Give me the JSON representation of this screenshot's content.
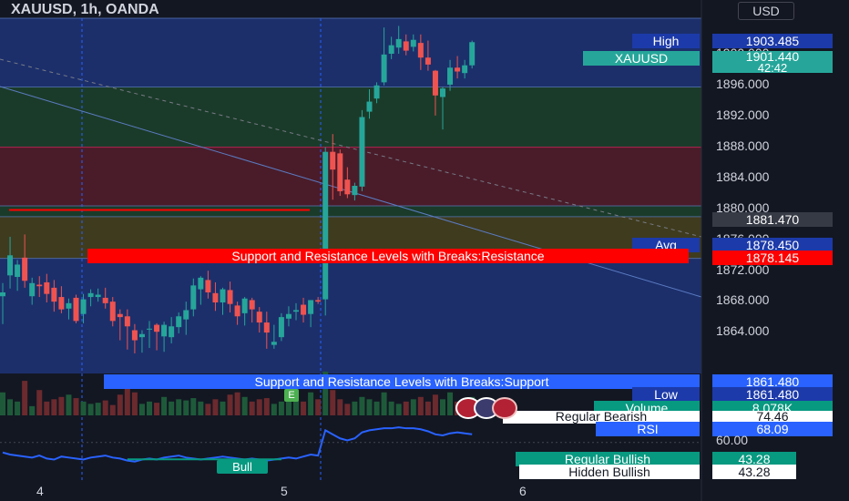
{
  "header": {
    "symbol_line": "XAUUSD, 1h, OANDA"
  },
  "currency_button": "USD",
  "colors": {
    "background": "#131722",
    "bull_candle": "#26a69a",
    "bear_candle": "#ef5350",
    "rsi_line": "#2962ff",
    "resistance_line": "#ff0000",
    "zone_blue": "#1c2f6b",
    "zone_green": "#1b3b2a",
    "zone_red": "#4a1c2a",
    "zone_olive": "#3f3b1e"
  },
  "labels": {
    "high_label": "High",
    "high_value": "1903.485",
    "symbol_label": "XAUUSD",
    "last_price": "1901.440",
    "countdown": "42:42",
    "crosshair_price": "1881.470",
    "avg_label": "Avg",
    "avg_value": "1878.450",
    "resistance_label": "Support and Resistance Levels with Breaks:Resistance",
    "resistance_value": "1878.145",
    "support_label": "Support and Resistance Levels with Breaks:Support",
    "support_value": "1861.480",
    "low_label": "Low",
    "low_value": "1861.480",
    "volume_label": "Volume",
    "volume_value": "8.078K",
    "regular_bearish_label": "Regular Bearish",
    "regular_bearish_value": "74.46",
    "rsi_label": "RSI",
    "rsi_value": "68.09",
    "rsi_level": "60.00",
    "regular_bullish_label": "Regular Bullish",
    "regular_bullish_value": "43.28",
    "hidden_bullish_label": "Hidden Bullish",
    "hidden_bullish_value": "43.28",
    "bull_marker": "Bull",
    "event_marker": "E"
  },
  "chart_data": {
    "type": "candlestick",
    "title": "XAUUSD, 1h, OANDA",
    "y_ticks": [
      "1900.000",
      "1896.000",
      "1892.000",
      "1888.000",
      "1884.000",
      "1880.000",
      "1876.000",
      "1872.000",
      "1868.000",
      "1864.000"
    ],
    "ylim": [
      1858.5,
      1904.5
    ],
    "x_ticks": [
      "4",
      "5",
      "6"
    ],
    "zones": [
      {
        "from": 1895.6,
        "to": 1904.5,
        "color": "blue"
      },
      {
        "from": 1887.8,
        "to": 1895.6,
        "color": "green"
      },
      {
        "from": 1880.2,
        "to": 1887.8,
        "color": "red"
      },
      {
        "from": 1878.8,
        "to": 1880.2,
        "color": "green"
      },
      {
        "from": 1873.4,
        "to": 1878.8,
        "color": "olive"
      },
      {
        "from": 1858.5,
        "to": 1873.4,
        "color": "blue"
      }
    ],
    "resistance_level": 1878.145,
    "support_level": 1861.48,
    "candles": [
      {
        "o": 1868.5,
        "h": 1870.2,
        "l": 1864.9,
        "c": 1869.0
      },
      {
        "o": 1871.2,
        "h": 1876.2,
        "l": 1869.5,
        "c": 1873.8
      },
      {
        "o": 1871.0,
        "h": 1873.2,
        "l": 1869.2,
        "c": 1872.6
      },
      {
        "o": 1873.5,
        "h": 1876.5,
        "l": 1869.6,
        "c": 1870.5
      },
      {
        "o": 1868.5,
        "h": 1870.9,
        "l": 1867.4,
        "c": 1870.2
      },
      {
        "o": 1870.0,
        "h": 1871.1,
        "l": 1868.4,
        "c": 1869.8
      },
      {
        "o": 1870.3,
        "h": 1871.4,
        "l": 1867.7,
        "c": 1868.8
      },
      {
        "o": 1869.6,
        "h": 1870.6,
        "l": 1866.5,
        "c": 1867.8
      },
      {
        "o": 1868.4,
        "h": 1869.8,
        "l": 1866.3,
        "c": 1866.8
      },
      {
        "o": 1866.9,
        "h": 1868.2,
        "l": 1865.5,
        "c": 1867.6
      },
      {
        "o": 1868.3,
        "h": 1868.7,
        "l": 1865.0,
        "c": 1865.3
      },
      {
        "o": 1866.2,
        "h": 1868.8,
        "l": 1865.0,
        "c": 1868.1
      },
      {
        "o": 1868.4,
        "h": 1869.4,
        "l": 1867.2,
        "c": 1868.9
      },
      {
        "o": 1868.4,
        "h": 1869.5,
        "l": 1867.8,
        "c": 1868.7
      },
      {
        "o": 1868.3,
        "h": 1869.6,
        "l": 1866.9,
        "c": 1867.6
      },
      {
        "o": 1867.8,
        "h": 1868.4,
        "l": 1864.6,
        "c": 1865.3
      },
      {
        "o": 1866.2,
        "h": 1866.8,
        "l": 1862.8,
        "c": 1865.8
      },
      {
        "o": 1865.9,
        "h": 1866.8,
        "l": 1861.6,
        "c": 1864.6
      },
      {
        "o": 1864.1,
        "h": 1864.9,
        "l": 1861.1,
        "c": 1862.8
      },
      {
        "o": 1863.2,
        "h": 1864.1,
        "l": 1861.2,
        "c": 1863.6
      },
      {
        "o": 1864.3,
        "h": 1865.3,
        "l": 1861.8,
        "c": 1864.3
      },
      {
        "o": 1864.8,
        "h": 1865.0,
        "l": 1861.5,
        "c": 1863.9
      },
      {
        "o": 1863.3,
        "h": 1865.2,
        "l": 1861.3,
        "c": 1864.8
      },
      {
        "o": 1863.2,
        "h": 1865.8,
        "l": 1862.4,
        "c": 1864.6
      },
      {
        "o": 1864.5,
        "h": 1866.4,
        "l": 1863.7,
        "c": 1865.9
      },
      {
        "o": 1865.5,
        "h": 1867.8,
        "l": 1863.5,
        "c": 1866.7
      },
      {
        "o": 1866.8,
        "h": 1870.8,
        "l": 1865.9,
        "c": 1869.9
      },
      {
        "o": 1869.4,
        "h": 1871.1,
        "l": 1867.4,
        "c": 1870.9
      },
      {
        "o": 1870.6,
        "h": 1871.8,
        "l": 1868.2,
        "c": 1869.0
      },
      {
        "o": 1868.9,
        "h": 1870.3,
        "l": 1866.6,
        "c": 1867.7
      },
      {
        "o": 1867.7,
        "h": 1869.6,
        "l": 1866.1,
        "c": 1869.4
      },
      {
        "o": 1869.3,
        "h": 1870.4,
        "l": 1866.4,
        "c": 1867.5
      },
      {
        "o": 1867.3,
        "h": 1867.8,
        "l": 1864.8,
        "c": 1865.9
      },
      {
        "o": 1866.3,
        "h": 1868.4,
        "l": 1864.7,
        "c": 1868.2
      },
      {
        "o": 1868.0,
        "h": 1868.3,
        "l": 1865.1,
        "c": 1866.8
      },
      {
        "o": 1866.5,
        "h": 1867.1,
        "l": 1863.8,
        "c": 1865.1
      },
      {
        "o": 1865.1,
        "h": 1866.5,
        "l": 1861.7,
        "c": 1863.8
      },
      {
        "o": 1862.2,
        "h": 1864.8,
        "l": 1861.7,
        "c": 1862.6
      },
      {
        "o": 1863.2,
        "h": 1866.3,
        "l": 1862.7,
        "c": 1865.8
      },
      {
        "o": 1865.6,
        "h": 1867.2,
        "l": 1864.6,
        "c": 1866.2
      },
      {
        "o": 1866.5,
        "h": 1867.6,
        "l": 1865.4,
        "c": 1866.7
      },
      {
        "o": 1867.4,
        "h": 1868.3,
        "l": 1865.1,
        "c": 1866.1
      },
      {
        "o": 1866.2,
        "h": 1868.0,
        "l": 1864.5,
        "c": 1868.0
      },
      {
        "o": 1868.0,
        "h": 1868.4,
        "l": 1867.5,
        "c": 1867.8
      },
      {
        "o": 1868.1,
        "h": 1887.8,
        "l": 1866.0,
        "c": 1887.2
      },
      {
        "o": 1887.2,
        "h": 1889.5,
        "l": 1881.0,
        "c": 1884.9
      },
      {
        "o": 1887.0,
        "h": 1887.5,
        "l": 1881.5,
        "c": 1882.1
      },
      {
        "o": 1883.6,
        "h": 1885.2,
        "l": 1881.2,
        "c": 1881.7
      },
      {
        "o": 1881.6,
        "h": 1883.2,
        "l": 1880.9,
        "c": 1882.8
      },
      {
        "o": 1882.7,
        "h": 1892.6,
        "l": 1882.1,
        "c": 1891.7
      },
      {
        "o": 1892.4,
        "h": 1895.3,
        "l": 1891.5,
        "c": 1893.7
      },
      {
        "o": 1894.1,
        "h": 1896.2,
        "l": 1893.5,
        "c": 1895.8
      },
      {
        "o": 1896.2,
        "h": 1903.3,
        "l": 1895.8,
        "c": 1899.8
      },
      {
        "o": 1899.9,
        "h": 1902.1,
        "l": 1899.2,
        "c": 1901.0
      },
      {
        "o": 1900.7,
        "h": 1903.5,
        "l": 1899.9,
        "c": 1901.8
      },
      {
        "o": 1901.5,
        "h": 1902.4,
        "l": 1899.7,
        "c": 1900.3
      },
      {
        "o": 1900.8,
        "h": 1902.4,
        "l": 1900.2,
        "c": 1901.7
      },
      {
        "o": 1901.3,
        "h": 1902.4,
        "l": 1897.8,
        "c": 1899.4
      },
      {
        "o": 1899.4,
        "h": 1901.6,
        "l": 1897.7,
        "c": 1898.5
      },
      {
        "o": 1897.7,
        "h": 1897.8,
        "l": 1891.9,
        "c": 1894.5
      },
      {
        "o": 1894.3,
        "h": 1895.6,
        "l": 1890.1,
        "c": 1895.4
      },
      {
        "o": 1895.9,
        "h": 1899.1,
        "l": 1895.1,
        "c": 1898.1
      },
      {
        "o": 1898.1,
        "h": 1899.6,
        "l": 1896.7,
        "c": 1897.6
      },
      {
        "o": 1897.4,
        "h": 1899.1,
        "l": 1896.7,
        "c": 1898.4
      },
      {
        "o": 1898.4,
        "h": 1901.6,
        "l": 1898.0,
        "c": 1901.4
      }
    ],
    "volume": [
      20,
      14,
      12,
      30,
      8,
      22,
      12,
      14,
      16,
      18,
      15,
      12,
      10,
      11,
      13,
      9,
      18,
      25,
      20,
      10,
      12,
      11,
      16,
      12,
      14,
      13,
      15,
      12,
      10,
      14,
      12,
      18,
      20,
      16,
      12,
      14,
      15,
      10,
      12,
      14,
      16,
      12,
      20,
      14,
      38,
      22,
      14,
      10,
      12,
      16,
      14,
      12,
      20,
      12,
      10,
      12,
      14,
      16,
      12,
      18,
      14,
      20,
      12,
      14,
      16
    ],
    "rsi": {
      "ylim": [
        20,
        85
      ],
      "values": [
        50,
        48,
        47,
        46,
        45,
        47,
        44,
        43,
        46,
        45,
        44,
        43,
        45,
        46,
        47,
        45,
        44,
        42,
        41,
        43,
        44,
        43,
        45,
        46,
        47,
        45,
        44,
        43,
        44,
        45,
        46,
        45,
        44,
        43,
        44,
        43,
        42,
        43,
        44,
        45,
        44,
        46,
        48,
        47,
        72,
        68,
        64,
        62,
        64,
        70,
        72,
        73,
        74,
        74,
        75,
        74,
        74,
        73,
        71,
        68,
        67,
        69,
        70,
        69,
        68.09
      ]
    },
    "rsi_bull_divergence": {
      "from_index": 17,
      "to_index": 38,
      "value": 43.28
    }
  }
}
